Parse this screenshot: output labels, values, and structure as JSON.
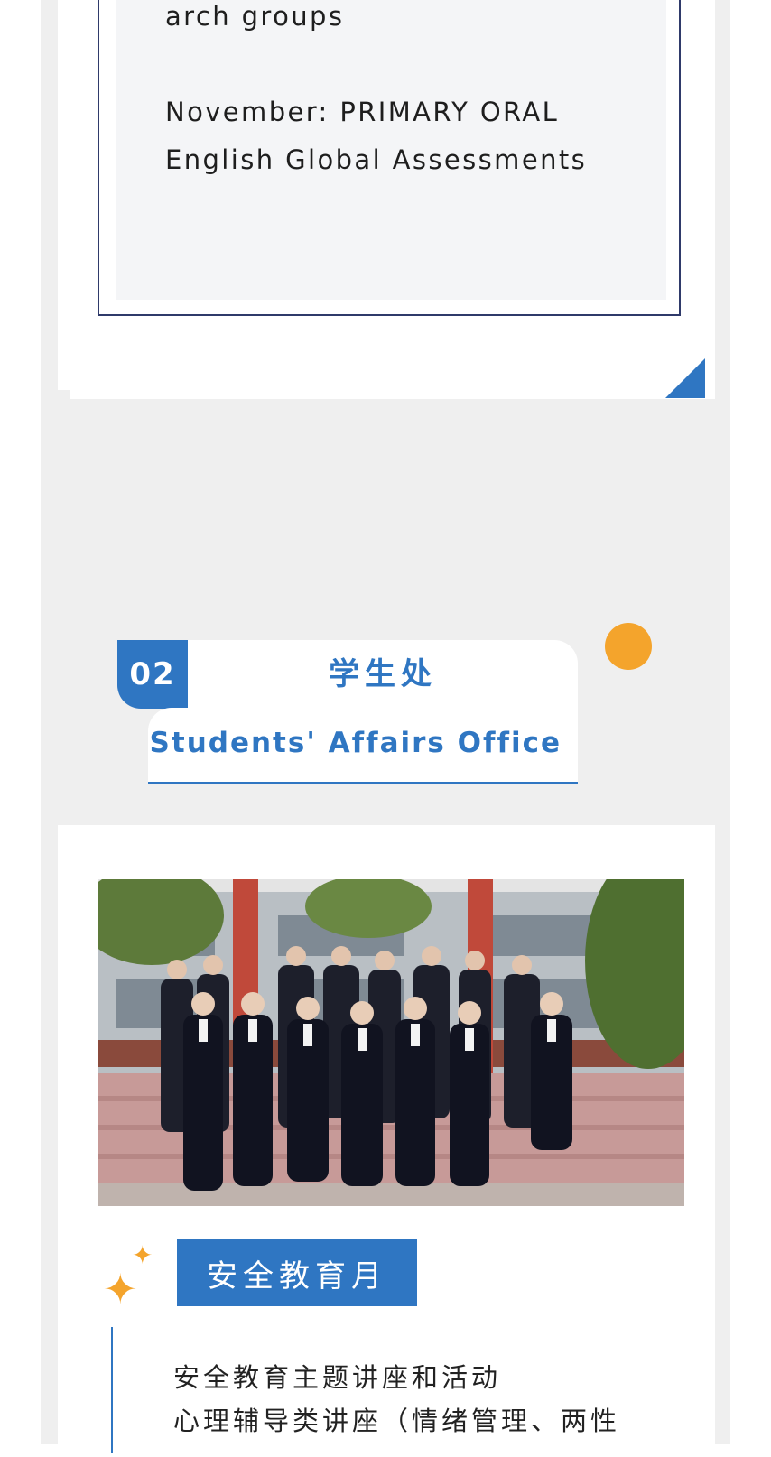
{
  "section_prev": {
    "line1": "arch groups",
    "line2": "November: PRIMARY ORAL English Global Assessments"
  },
  "section_header": {
    "number": "02",
    "title_cn": "学生处",
    "title_en": "Students' Affairs Office"
  },
  "safety": {
    "tag": "安全教育月",
    "lines": [
      "安全教育主题讲座和活动",
      "心理辅导类讲座（情绪管理、两性"
    ]
  },
  "colors": {
    "accent": "#2f76c2",
    "orange": "#f4a42c",
    "frame": "#2f3a6a"
  },
  "icons": [
    "sparkle-icon",
    "corner-triangle"
  ]
}
